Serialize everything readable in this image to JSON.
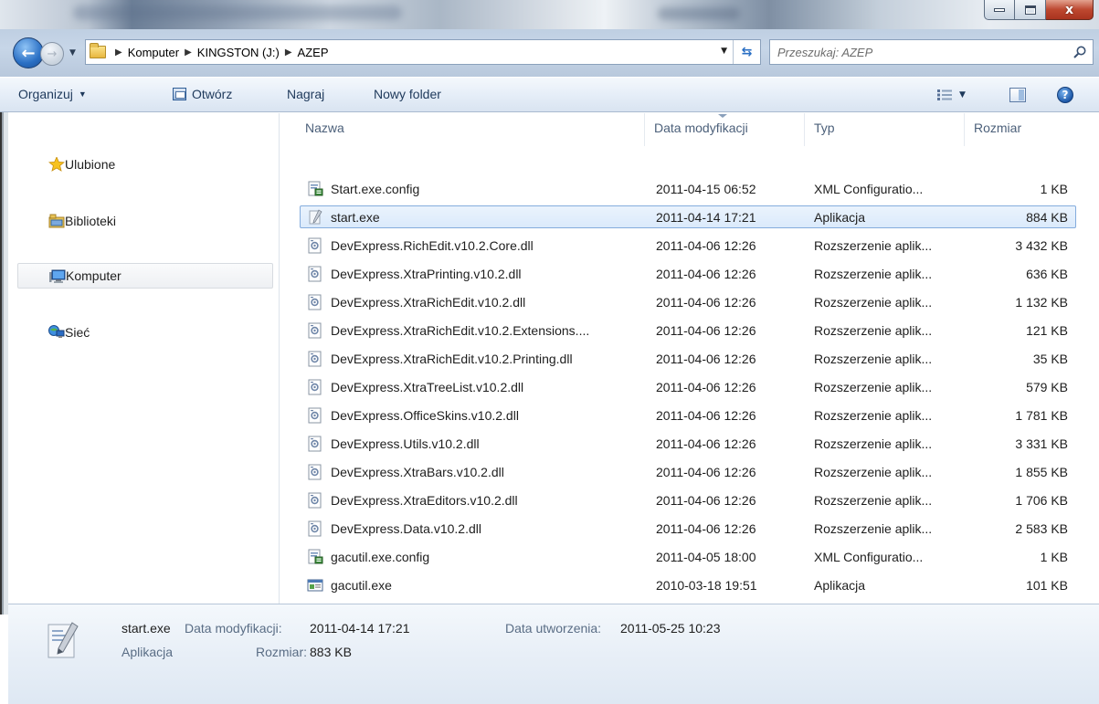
{
  "window": {
    "controls": {
      "minimize": "minimize",
      "maximize": "maximize",
      "close": "x"
    }
  },
  "address": {
    "breadcrumbs": [
      "Komputer",
      "KINGSTON (J:)",
      "AZEP"
    ],
    "search_placeholder": "Przeszukaj: AZEP"
  },
  "toolbar": {
    "organize": "Organizuj",
    "open": "Otwórz",
    "burn": "Nagraj",
    "new_folder": "Nowy folder"
  },
  "nav": {
    "items": [
      {
        "label": "Ulubione",
        "icon": "star-icon"
      },
      {
        "label": "Biblioteki",
        "icon": "libraries-icon"
      },
      {
        "label": "Komputer",
        "icon": "computer-icon",
        "selected": true
      },
      {
        "label": "Sieć",
        "icon": "network-icon"
      }
    ]
  },
  "columns": {
    "name": "Nazwa",
    "date": "Data modyfikacji",
    "type": "Typ",
    "size": "Rozmiar"
  },
  "files": [
    {
      "name": "Start.exe.config",
      "date": "2011-04-15 06:52",
      "type": "XML Configuratio...",
      "size": "1 KB",
      "icon": "config-file-icon"
    },
    {
      "name": "start.exe",
      "date": "2011-04-14 17:21",
      "type": "Aplikacja",
      "size": "884 KB",
      "icon": "app-exe-icon",
      "selected": true
    },
    {
      "name": "DevExpress.RichEdit.v10.2.Core.dll",
      "date": "2011-04-06 12:26",
      "type": "Rozszerzenie aplik...",
      "size": "3 432 KB",
      "icon": "dll-icon"
    },
    {
      "name": "DevExpress.XtraPrinting.v10.2.dll",
      "date": "2011-04-06 12:26",
      "type": "Rozszerzenie aplik...",
      "size": "636 KB",
      "icon": "dll-icon"
    },
    {
      "name": "DevExpress.XtraRichEdit.v10.2.dll",
      "date": "2011-04-06 12:26",
      "type": "Rozszerzenie aplik...",
      "size": "1 132 KB",
      "icon": "dll-icon"
    },
    {
      "name": "DevExpress.XtraRichEdit.v10.2.Extensions....",
      "date": "2011-04-06 12:26",
      "type": "Rozszerzenie aplik...",
      "size": "121 KB",
      "icon": "dll-icon"
    },
    {
      "name": "DevExpress.XtraRichEdit.v10.2.Printing.dll",
      "date": "2011-04-06 12:26",
      "type": "Rozszerzenie aplik...",
      "size": "35 KB",
      "icon": "dll-icon"
    },
    {
      "name": "DevExpress.XtraTreeList.v10.2.dll",
      "date": "2011-04-06 12:26",
      "type": "Rozszerzenie aplik...",
      "size": "579 KB",
      "icon": "dll-icon"
    },
    {
      "name": "DevExpress.OfficeSkins.v10.2.dll",
      "date": "2011-04-06 12:26",
      "type": "Rozszerzenie aplik...",
      "size": "1 781 KB",
      "icon": "dll-icon"
    },
    {
      "name": "DevExpress.Utils.v10.2.dll",
      "date": "2011-04-06 12:26",
      "type": "Rozszerzenie aplik...",
      "size": "3 331 KB",
      "icon": "dll-icon"
    },
    {
      "name": "DevExpress.XtraBars.v10.2.dll",
      "date": "2011-04-06 12:26",
      "type": "Rozszerzenie aplik...",
      "size": "1 855 KB",
      "icon": "dll-icon"
    },
    {
      "name": "DevExpress.XtraEditors.v10.2.dll",
      "date": "2011-04-06 12:26",
      "type": "Rozszerzenie aplik...",
      "size": "1 706 KB",
      "icon": "dll-icon"
    },
    {
      "name": "DevExpress.Data.v10.2.dll",
      "date": "2011-04-06 12:26",
      "type": "Rozszerzenie aplik...",
      "size": "2 583 KB",
      "icon": "dll-icon"
    },
    {
      "name": "gacutil.exe.config",
      "date": "2011-04-05 18:00",
      "type": "XML Configuratio...",
      "size": "1 KB",
      "icon": "config-file-icon"
    },
    {
      "name": "gacutil.exe",
      "date": "2010-03-18 19:51",
      "type": "Aplikacja",
      "size": "101 KB",
      "icon": "console-exe-icon"
    }
  ],
  "details": {
    "filename": "start.exe",
    "modified_label": "Data modyfikacji:",
    "modified_value": "2011-04-14 17:21",
    "created_label": "Data utworzenia:",
    "created_value": "2011-05-25 10:23",
    "type_value": "Aplikacja",
    "size_label": "Rozmiar:",
    "size_value": "883 KB"
  },
  "colors": {
    "selection_fill": "#dbeafb",
    "selection_border": "#84acdd",
    "toolbar_text": "#1e395b",
    "header_text": "#4c607a",
    "detail_label": "#5a6d85"
  }
}
